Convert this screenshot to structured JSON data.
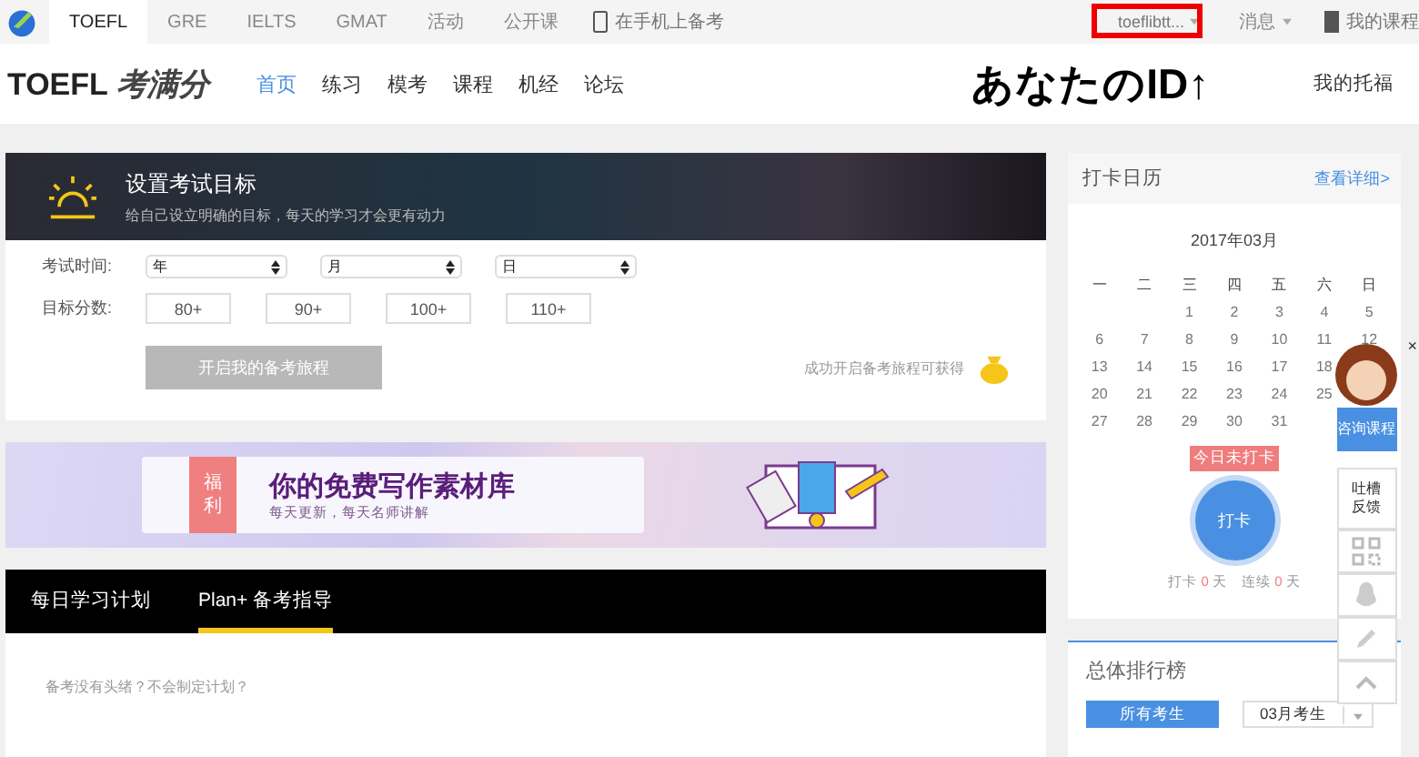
{
  "top_nav": {
    "tabs": [
      {
        "label": "TOEFL",
        "selected": true
      },
      {
        "label": "GRE",
        "selected": false
      },
      {
        "label": "IELTS",
        "selected": false
      },
      {
        "label": "GMAT",
        "selected": false
      },
      {
        "label": "活动",
        "selected": false
      },
      {
        "label": "公开课",
        "selected": false
      }
    ],
    "mobile_link": "在手机上备考",
    "user_id": "toeflibtt...",
    "messages": "消息",
    "my_courses": "我的课程"
  },
  "header": {
    "logo_text": "TOEFL",
    "logo_brand": "考满分",
    "nav": [
      {
        "label": "首页",
        "selected": true
      },
      {
        "label": "练习",
        "selected": false
      },
      {
        "label": "模考",
        "selected": false
      },
      {
        "label": "课程",
        "selected": false
      },
      {
        "label": "机经",
        "selected": false
      },
      {
        "label": "论坛",
        "selected": false
      }
    ],
    "my_toefl": "我的托福"
  },
  "annotation": "あなたのID↑",
  "goal_card": {
    "title": "设置考试目标",
    "subtitle": "给自己设立明确的目标，每天的学习才会更有动力",
    "date_label": "考试时间:",
    "selects": [
      "年",
      "月",
      "日"
    ],
    "score_label": "目标分数:",
    "scores": [
      {
        "label": "80+",
        "selected": false
      },
      {
        "label": "90+",
        "selected": false
      },
      {
        "label": "100+",
        "selected": false
      },
      {
        "label": "110+",
        "selected": false
      }
    ],
    "start_button": {
      "label": "开启我的备考旅程",
      "disabled": true
    },
    "reward_text": "成功开启备考旅程可获得"
  },
  "ad_banner": {
    "tag": "福利",
    "title": "你的免费写作素材库",
    "subtitle": "每天更新，每天名师讲解"
  },
  "plan_tabs": {
    "tabs": [
      {
        "label": "每日学习计划",
        "selected": false
      },
      {
        "label": "Plan+ 备考指导",
        "selected": true
      }
    ],
    "prompt": "备考没有头绪？不会制定计划？"
  },
  "calendar": {
    "title": "打卡日历",
    "detail_link": "查看详细>",
    "month": "2017年03月",
    "weekdays": [
      "一",
      "二",
      "三",
      "四",
      "五",
      "六",
      "日"
    ],
    "weeks": [
      [
        "1",
        "2",
        "3",
        "4",
        "5"
      ],
      [
        "6",
        "7",
        "8",
        "9",
        "10",
        "11",
        "12"
      ],
      [
        "13",
        "14",
        "15",
        "16",
        "17",
        "18"
      ],
      [
        "20",
        "21",
        "22",
        "23",
        "24",
        "25"
      ],
      [
        "27",
        "28",
        "29",
        "30",
        "31"
      ]
    ],
    "status": "今日未打卡",
    "checkin_button": "打卡",
    "stats": [
      {
        "label": "打卡",
        "value": "0",
        "unit": "天"
      },
      {
        "label": "连续",
        "value": "0",
        "unit": "天"
      }
    ]
  },
  "ranking": {
    "title": "总体排行榜",
    "tabs": [
      {
        "label": "所有考生",
        "selected": true
      }
    ],
    "month_select": "03月考生"
  },
  "float_widget": {
    "close": "×",
    "consult": "咨询课程",
    "feedback": "吐槽反馈"
  }
}
